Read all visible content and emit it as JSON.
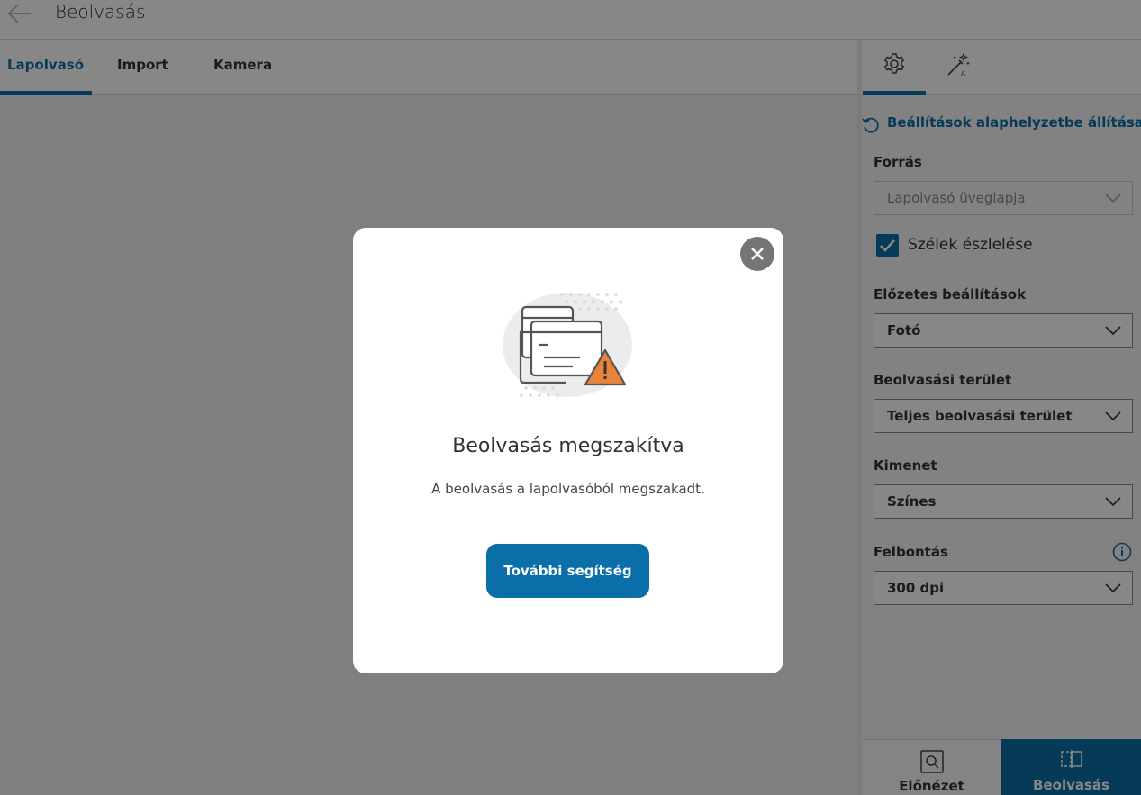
{
  "header": {
    "title": "Beolvasás",
    "back_icon": "arrow-left-icon"
  },
  "tabs": [
    {
      "label": "Lapolvasó",
      "active": true
    },
    {
      "label": "Import",
      "active": false
    },
    {
      "label": "Kamera",
      "active": false
    }
  ],
  "side_tabs": [
    {
      "icon": "gear-icon",
      "active": true
    },
    {
      "icon": "magic-wand-icon",
      "active": false
    }
  ],
  "panel": {
    "reset_label": "Beállítások alaphelyzetbe állítása",
    "source": {
      "label": "Forrás",
      "value": "Lapolvasó üveglapja",
      "disabled": true
    },
    "edge_detection": {
      "label": "Szélek észlelése",
      "checked": true
    },
    "presets": {
      "label": "Előzetes beállítások",
      "value": "Fotó"
    },
    "scan_area": {
      "label": "Beolvasási terület",
      "value": "Teljes beolvasási terület"
    },
    "output": {
      "label": "Kimenet",
      "value": "Színes"
    },
    "resolution": {
      "label": "Felbontás",
      "value": "300 dpi",
      "info_icon": "info-icon"
    }
  },
  "bottom": {
    "preview_label": "Előnézet",
    "scan_label": "Beolvasás"
  },
  "dialog": {
    "title": "Beolvasás megszakítva",
    "message": "A beolvasás a lapolvasóból megszakadt.",
    "button_label": "További segítség",
    "illustration": "scanner-warning-illustration"
  },
  "colors": {
    "accent": "#0a6ea8",
    "warning": "#e8833a",
    "overlay": "rgba(0,0,0,0.47)"
  }
}
